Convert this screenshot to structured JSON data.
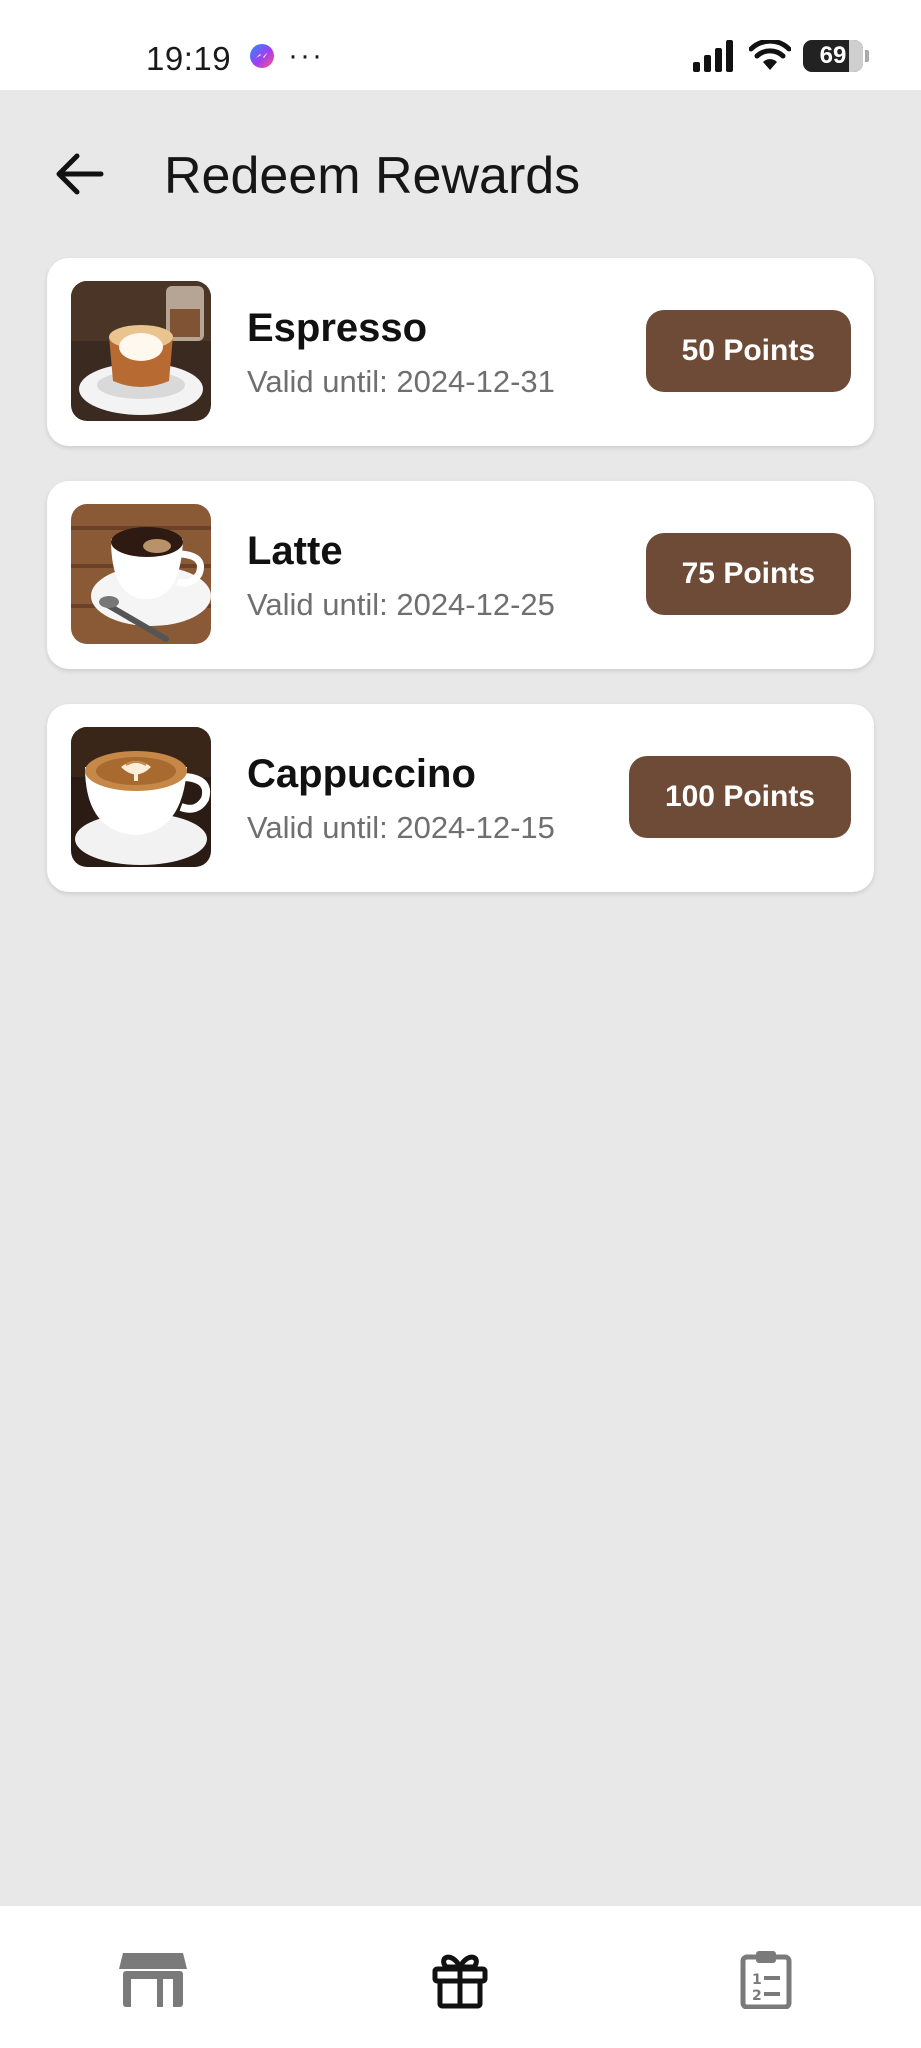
{
  "status_bar": {
    "time": "19:19",
    "more_indicator": "···",
    "battery_level": "69",
    "icons": [
      "messenger-icon",
      "signal-icon",
      "wifi-icon",
      "battery-icon"
    ]
  },
  "header": {
    "title": "Redeem Rewards",
    "back_icon": "arrow-left-icon"
  },
  "rewards": [
    {
      "name": "Espresso",
      "valid": "Valid until: 2024-12-31",
      "points": "50 Points",
      "image": "espresso-image"
    },
    {
      "name": "Latte",
      "valid": "Valid until: 2024-12-25",
      "points": "75 Points",
      "image": "latte-image"
    },
    {
      "name": "Cappuccino",
      "valid": "Valid until: 2024-12-15",
      "points": "100 Points",
      "image": "cappuccino-image"
    }
  ],
  "bottom_nav": {
    "items": [
      {
        "icon": "store-icon",
        "active": false
      },
      {
        "icon": "gift-icon",
        "active": true
      },
      {
        "icon": "clipboard-list-icon",
        "active": false
      }
    ]
  },
  "colors": {
    "accent": "#6e4b36",
    "background": "#e8e8e8",
    "card": "#ffffff",
    "nav_inactive": "#7a7a7a",
    "nav_active": "#111111"
  }
}
